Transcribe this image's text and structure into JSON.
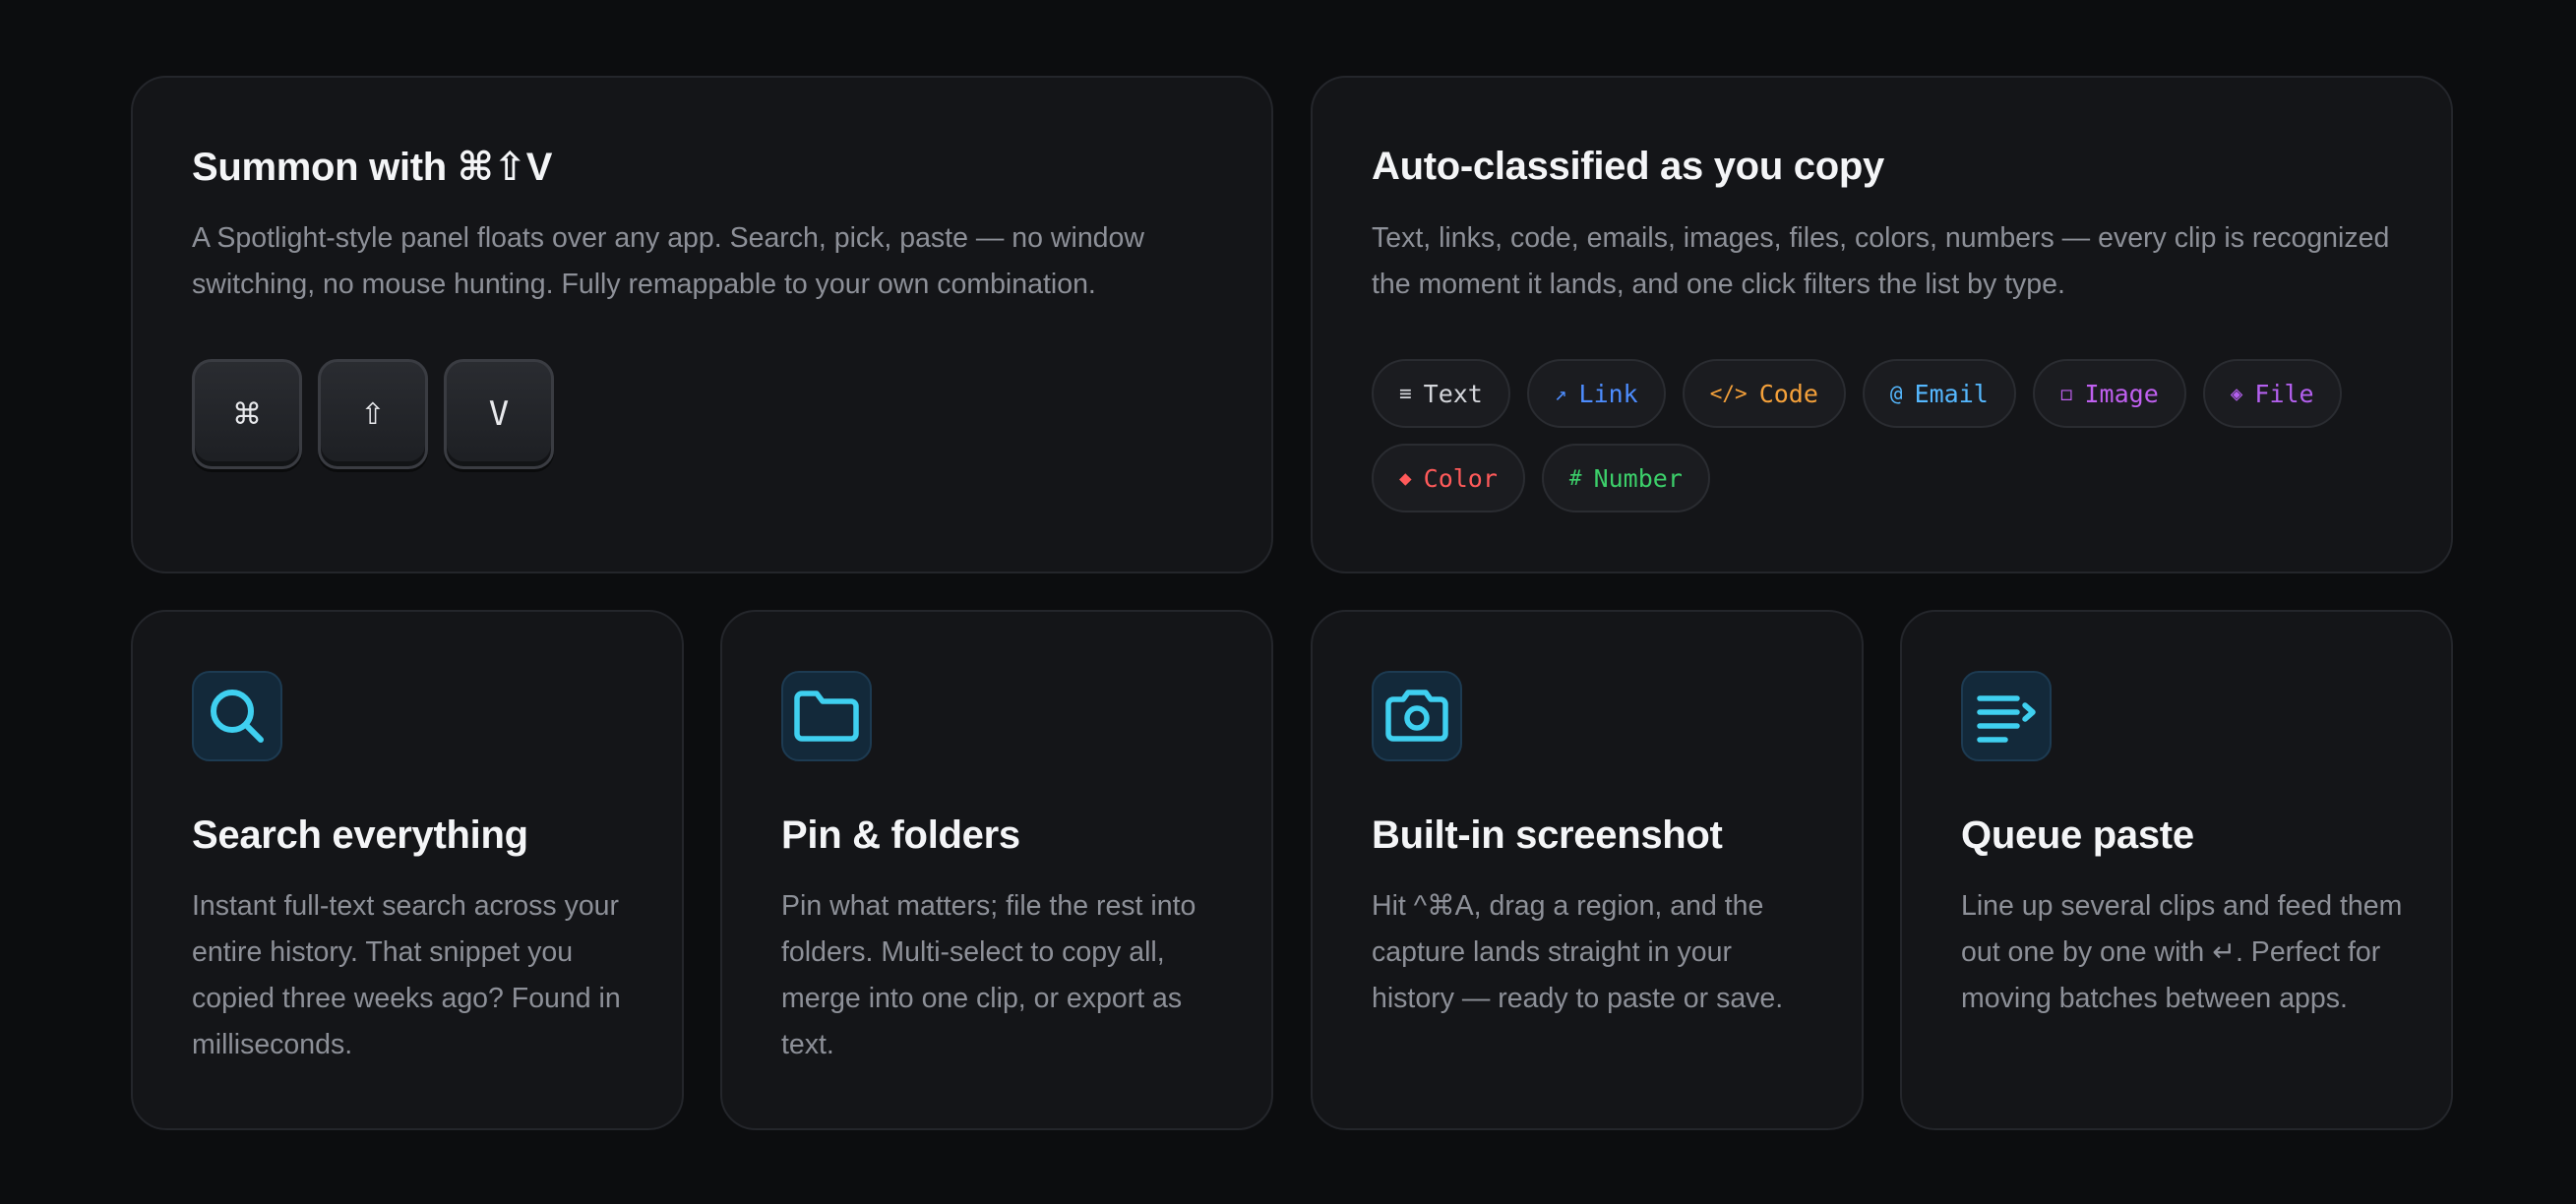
{
  "colors": {
    "background": "#0c0d0f",
    "card": "#141518",
    "accent": "#3fd0f0",
    "text_link": "#4d8dff",
    "code": "#f5a13a",
    "email": "#55b8ff",
    "image": "#c060f0",
    "file": "#b560f0",
    "color": "#ff5a5a",
    "number": "#3ccf6a"
  },
  "summon": {
    "title": "Summon with ⌘⇧V",
    "description": "A Spotlight-style panel floats over any app. Search, pick, paste — no window switching, no mouse hunting. Fully remappable to your own combination.",
    "keys": [
      "⌘",
      "⇧",
      "V"
    ]
  },
  "classify": {
    "title": "Auto-classified as you copy",
    "description": "Text, links, code, emails, images, files, colors, numbers — every clip is recognized the moment it lands, and one click filters the list by type.",
    "tags": [
      {
        "glyph": "≡",
        "label": "Text",
        "color": "#d4d6db"
      },
      {
        "glyph": "↗",
        "label": "Link",
        "color": "#4d8dff"
      },
      {
        "glyph": "</>",
        "label": "Code",
        "color": "#f5a13a"
      },
      {
        "glyph": "@",
        "label": "Email",
        "color": "#55b8ff"
      },
      {
        "glyph": "◻",
        "label": "Image",
        "color": "#c060f0"
      },
      {
        "glyph": "◈",
        "label": "File",
        "color": "#b560f0"
      },
      {
        "glyph": "◆",
        "label": "Color",
        "color": "#ff5a5a"
      },
      {
        "glyph": "#",
        "label": "Number",
        "color": "#3ccf6a"
      }
    ]
  },
  "features": [
    {
      "icon": "search-icon",
      "title": "Search everything",
      "description": "Instant full-text search across your entire history. That snippet you copied three weeks ago? Found in milliseconds."
    },
    {
      "icon": "folder-icon",
      "title": "Pin & folders",
      "description": "Pin what matters; file the rest into folders. Multi-select to copy all, merge into one clip, or export as text."
    },
    {
      "icon": "camera-icon",
      "title": "Built-in screenshot",
      "description": "Hit ^⌘A, drag a region, and the capture lands straight in your history — ready to paste or save."
    },
    {
      "icon": "queue-list-icon",
      "title": "Queue paste",
      "description": "Line up several clips and feed them out one by one with ↵. Perfect for moving batches between apps."
    }
  ]
}
